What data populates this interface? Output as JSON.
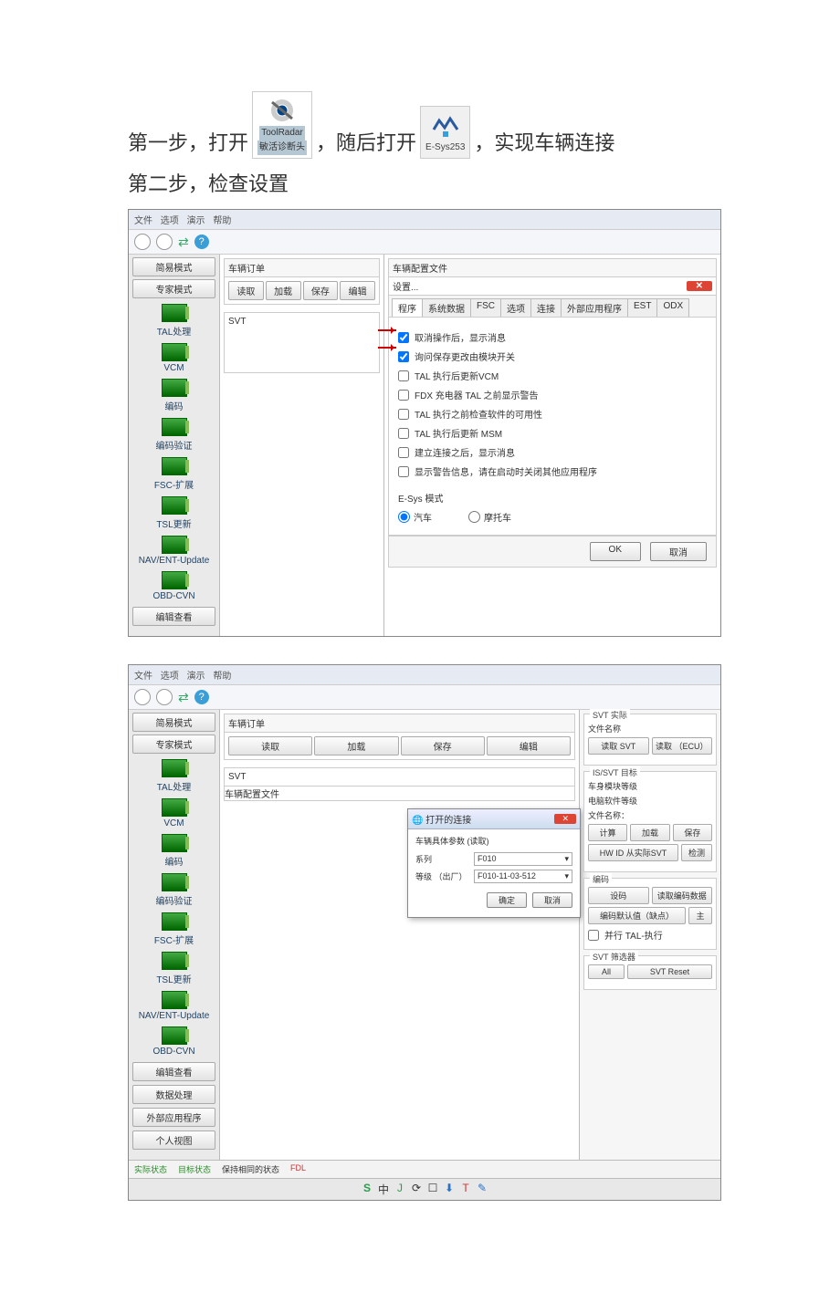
{
  "step1": {
    "prefix": "第一步，打开",
    "mid": "，随后打开",
    "suffix": "，实现车辆连接"
  },
  "icon1_label": "ToolRadar",
  "icon1_sub": "敏活诊断头",
  "icon2_label": "E-Sys253",
  "step2": "第二步，检查设置",
  "menu": {
    "file": "文件",
    "opt": "选项",
    "view": "演示",
    "help": "帮助"
  },
  "sidebar": {
    "simple": "简易模式",
    "expert": "专家模式",
    "items": [
      "TAL处理",
      "VCM",
      "编码",
      "编码验证",
      "FSC-扩展",
      "TSL更新",
      "NAV/ENT-Update",
      "OBD-CVN"
    ],
    "extra": [
      "编辑查看",
      "数据处理",
      "外部应用程序",
      "个人视图"
    ]
  },
  "mid": {
    "vehOrder": "车辆订单",
    "read": "读取",
    "load": "加载",
    "save": "保存",
    "edit": "编辑",
    "svt": "SVT"
  },
  "right": {
    "hdr": "车辆配置文件",
    "settings": "设置...",
    "tabs": [
      "程序",
      "系统数据",
      "FSC",
      "选项",
      "连接",
      "外部应用程序",
      "EST",
      "ODX"
    ],
    "chk": [
      "取消操作后，显示消息",
      "询问保存更改由模块开关",
      "TAL 执行后更新VCM",
      "FDX 充电器 TAL 之前显示警告",
      "TAL 执行之前检查软件的可用性",
      "TAL 执行后更新 MSM",
      "建立连接之后，显示消息",
      "显示警告信息，请在启动时关闭其他应用程序"
    ],
    "mode_lbl": "E-Sys 模式",
    "radio_car": "汽车",
    "radio_moto": "摩托车",
    "ok": "OK",
    "cancel": "取消"
  },
  "popup": {
    "title": "打开的连接",
    "sub": "车辆具体参数 (读取)",
    "f1": "系列",
    "v1": "F010",
    "f2": "等级 （出厂）",
    "v2": "F010-11-03-512",
    "ok": "确定",
    "cancel": "取消"
  },
  "right2": {
    "svt_act": "SVT 实际",
    "file_name": "文件名称",
    "read_svt": "读取 SVT",
    "read_ecu": "读取 （ECU）",
    "target": "IS/SVT 目标",
    "body_lvl": "车身模块等级",
    "chip_lvl": "电脑软件等级",
    "file_name2": "文件名称：",
    "calc": "计算",
    "load": "加载",
    "save": "保存",
    "hwid": "HW ID 从实际SVT",
    "check": "检测",
    "code": "编码",
    "setcode": "设码",
    "readcode": "读取编码数据",
    "codedef": "编码默认值（缺点）",
    "more": "主",
    "paratal": "并行 TAL-执行",
    "filter": "SVT 筛选器",
    "all": "All",
    "reset": "SVT Reset"
  },
  "status": {
    "actual": "实际状态",
    "target": "目标状态",
    "keep": "保持相同的状态",
    "fdl": "FDL"
  },
  "tray_icons": [
    "S",
    "中",
    "J",
    "⟳",
    "☐",
    "⬇",
    "T",
    "✎"
  ]
}
